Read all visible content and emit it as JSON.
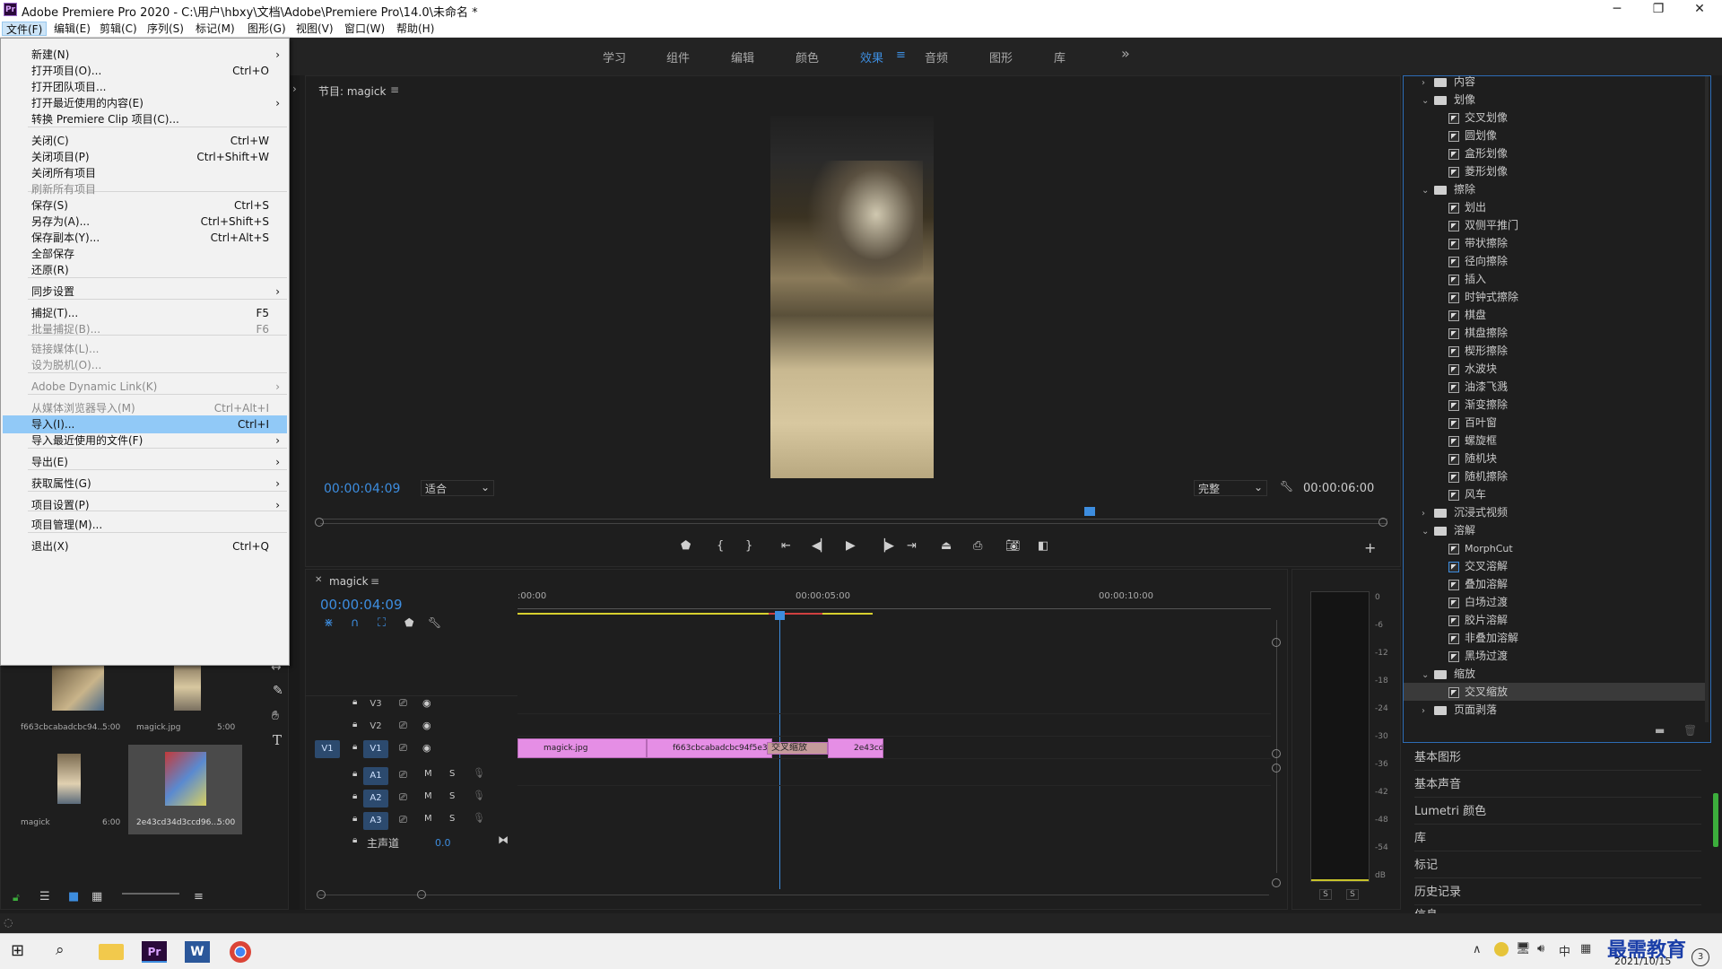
{
  "window": {
    "title": "Adobe Premiere Pro 2020 - C:\\用户\\hbxy\\文档\\Adobe\\Premiere Pro\\14.0\\未命名 *",
    "logo": "Pr"
  },
  "menubar": [
    "文件(F)",
    "编辑(E)",
    "剪辑(C)",
    "序列(S)",
    "标记(M)",
    "图形(G)",
    "视图(V)",
    "窗口(W)",
    "帮助(H)"
  ],
  "workspaces": [
    "学习",
    "组件",
    "编辑",
    "颜色",
    "效果",
    "音频",
    "图形",
    "库"
  ],
  "workspace_active": "效果",
  "workspace_more": "»",
  "file_menu": [
    {
      "label": "新建(N)",
      "shortcut": "",
      "arrow": "›",
      "disabled": false
    },
    {
      "label": "打开项目(O)...",
      "shortcut": "Ctrl+O",
      "arrow": "",
      "disabled": false
    },
    {
      "label": "打开团队项目...",
      "shortcut": "",
      "arrow": "",
      "disabled": false
    },
    {
      "label": "打开最近使用的内容(E)",
      "shortcut": "",
      "arrow": "›",
      "disabled": false
    },
    {
      "label": "转换 Premiere Clip 项目(C)...",
      "shortcut": "",
      "arrow": "",
      "disabled": false
    },
    {
      "label": "关闭(C)",
      "shortcut": "Ctrl+W",
      "arrow": "",
      "disabled": false
    },
    {
      "label": "关闭项目(P)",
      "shortcut": "Ctrl+Shift+W",
      "arrow": "",
      "disabled": false
    },
    {
      "label": "关闭所有项目",
      "shortcut": "",
      "arrow": "",
      "disabled": false
    },
    {
      "label": "刷新所有项目",
      "shortcut": "",
      "arrow": "",
      "disabled": true
    },
    {
      "label": "保存(S)",
      "shortcut": "Ctrl+S",
      "arrow": "",
      "disabled": false
    },
    {
      "label": "另存为(A)...",
      "shortcut": "Ctrl+Shift+S",
      "arrow": "",
      "disabled": false
    },
    {
      "label": "保存副本(Y)...",
      "shortcut": "Ctrl+Alt+S",
      "arrow": "",
      "disabled": false
    },
    {
      "label": "全部保存",
      "shortcut": "",
      "arrow": "",
      "disabled": false
    },
    {
      "label": "还原(R)",
      "shortcut": "",
      "arrow": "",
      "disabled": false
    },
    {
      "label": "同步设置",
      "shortcut": "",
      "arrow": "›",
      "disabled": false
    },
    {
      "label": "捕捉(T)...",
      "shortcut": "F5",
      "arrow": "",
      "disabled": false
    },
    {
      "label": "批量捕捉(B)...",
      "shortcut": "F6",
      "arrow": "",
      "disabled": true
    },
    {
      "label": "链接媒体(L)...",
      "shortcut": "",
      "arrow": "",
      "disabled": true
    },
    {
      "label": "设为脱机(O)...",
      "shortcut": "",
      "arrow": "",
      "disabled": true
    },
    {
      "label": "Adobe Dynamic Link(K)",
      "shortcut": "",
      "arrow": "›",
      "disabled": true
    },
    {
      "label": "从媒体浏览器导入(M)",
      "shortcut": "Ctrl+Alt+I",
      "arrow": "",
      "disabled": true
    },
    {
      "label": "导入(I)...",
      "shortcut": "Ctrl+I",
      "arrow": "",
      "disabled": false
    },
    {
      "label": "导入最近使用的文件(F)",
      "shortcut": "",
      "arrow": "›",
      "disabled": false
    },
    {
      "label": "导出(E)",
      "shortcut": "",
      "arrow": "›",
      "disabled": false
    },
    {
      "label": "获取属性(G)",
      "shortcut": "",
      "arrow": "›",
      "disabled": false
    },
    {
      "label": "项目设置(P)",
      "shortcut": "",
      "arrow": "›",
      "disabled": false
    },
    {
      "label": "项目管理(M)...",
      "shortcut": "",
      "arrow": "",
      "disabled": false
    },
    {
      "label": "退出(X)",
      "shortcut": "Ctrl+Q",
      "arrow": "",
      "disabled": false
    }
  ],
  "program_monitor": {
    "title": "节目: magick",
    "timecode": "00:00:04:09",
    "fit": "适合",
    "quality": "完整",
    "duration": "00:00:06:00"
  },
  "timeline": {
    "tab": "magick",
    "timecode": "00:00:04:09",
    "ruler": [
      ":00:00",
      "00:00:05:00",
      "00:00:10:00"
    ],
    "video_tracks": [
      "V3",
      "V2",
      "V1"
    ],
    "audio_tracks": [
      "A1",
      "A2",
      "A3"
    ],
    "source_patch": "V1",
    "master_label": "主声道",
    "master_value": "0.0",
    "clips": [
      "magick.jpg",
      "f663cbcabadcbc94f5e34",
      "交叉缩放",
      "2e43cd"
    ],
    "audio_btn_m": "M",
    "audio_btn_s": "S"
  },
  "project_bin": [
    {
      "name": "f663cbcabadcbc94...",
      "dur": "5:00"
    },
    {
      "name": "magick.jpg",
      "dur": "5:00"
    },
    {
      "name": "magick",
      "dur": "6:00"
    },
    {
      "name": "2e43cd34d3ccd96...",
      "dur": "5:00"
    }
  ],
  "effects_tree": [
    {
      "type": "folder",
      "label": "内容",
      "open": false,
      "indent": 0
    },
    {
      "type": "folder",
      "label": "划像",
      "open": true,
      "indent": 0
    },
    {
      "type": "fx",
      "label": "交叉划像",
      "indent": 1
    },
    {
      "type": "fx",
      "label": "圆划像",
      "indent": 1
    },
    {
      "type": "fx",
      "label": "盒形划像",
      "indent": 1
    },
    {
      "type": "fx",
      "label": "菱形划像",
      "indent": 1
    },
    {
      "type": "folder",
      "label": "擦除",
      "open": true,
      "indent": 0
    },
    {
      "type": "fx",
      "label": "划出",
      "indent": 1
    },
    {
      "type": "fx",
      "label": "双侧平推门",
      "indent": 1
    },
    {
      "type": "fx",
      "label": "带状擦除",
      "indent": 1
    },
    {
      "type": "fx",
      "label": "径向擦除",
      "indent": 1
    },
    {
      "type": "fx",
      "label": "插入",
      "indent": 1
    },
    {
      "type": "fx",
      "label": "时钟式擦除",
      "indent": 1
    },
    {
      "type": "fx",
      "label": "棋盘",
      "indent": 1
    },
    {
      "type": "fx",
      "label": "棋盘擦除",
      "indent": 1
    },
    {
      "type": "fx",
      "label": "楔形擦除",
      "indent": 1
    },
    {
      "type": "fx",
      "label": "水波块",
      "indent": 1
    },
    {
      "type": "fx",
      "label": "油漆飞溅",
      "indent": 1
    },
    {
      "type": "fx",
      "label": "渐变擦除",
      "indent": 1
    },
    {
      "type": "fx",
      "label": "百叶窗",
      "indent": 1
    },
    {
      "type": "fx",
      "label": "螺旋框",
      "indent": 1
    },
    {
      "type": "fx",
      "label": "随机块",
      "indent": 1
    },
    {
      "type": "fx",
      "label": "随机擦除",
      "indent": 1
    },
    {
      "type": "fx",
      "label": "风车",
      "indent": 1
    },
    {
      "type": "folder",
      "label": "沉浸式视频",
      "open": false,
      "indent": 0
    },
    {
      "type": "folder",
      "label": "溶解",
      "open": true,
      "indent": 0
    },
    {
      "type": "fx",
      "label": "MorphCut",
      "indent": 1
    },
    {
      "type": "fx",
      "label": "交叉溶解",
      "indent": 1
    },
    {
      "type": "fx",
      "label": "叠加溶解",
      "indent": 1
    },
    {
      "type": "fx",
      "label": "白场过渡",
      "indent": 1
    },
    {
      "type": "fx",
      "label": "胶片溶解",
      "indent": 1
    },
    {
      "type": "fx",
      "label": "非叠加溶解",
      "indent": 1
    },
    {
      "type": "fx",
      "label": "黑场过渡",
      "indent": 1
    },
    {
      "type": "folder",
      "label": "缩放",
      "open": true,
      "indent": 0
    },
    {
      "type": "fx",
      "label": "交叉缩放",
      "indent": 1,
      "selected": true
    },
    {
      "type": "folder",
      "label": "页面剥落",
      "open": false,
      "indent": 0
    }
  ],
  "side_panels": [
    "基本图形",
    "基本声音",
    "Lumetri 颜色",
    "库",
    "标记",
    "历史记录",
    "信息"
  ],
  "audio_meter": {
    "scale": [
      "0",
      "-6",
      "-12",
      "-18",
      "-24",
      "-30",
      "-36",
      "-42",
      "-48",
      "-54",
      "dB"
    ],
    "solo": [
      "S",
      "S"
    ]
  },
  "taskbar": {
    "ime": "中",
    "date": "2021/10/15",
    "watermark": "最需教育"
  }
}
